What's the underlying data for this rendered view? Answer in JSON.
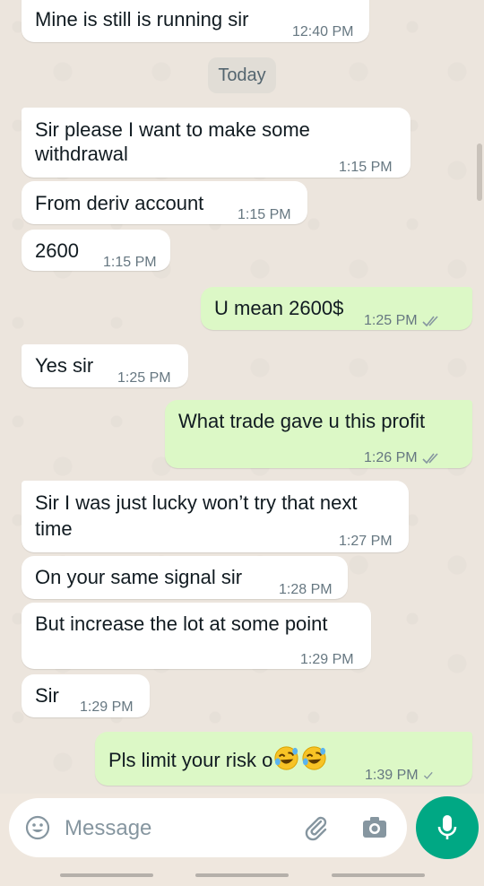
{
  "date_separator": "Today",
  "messages": [
    {
      "text": "Mine is still is running sir",
      "time": "12:40 PM",
      "direction": "in"
    },
    {
      "text_lines": [
        "Sir please I want to make some",
        "withdrawal"
      ],
      "time": "1:15 PM",
      "direction": "in"
    },
    {
      "text": "From deriv account",
      "time": "1:15 PM",
      "direction": "in"
    },
    {
      "text": "2600",
      "time": "1:15 PM",
      "direction": "in"
    },
    {
      "text": "U mean 2600$",
      "time": "1:25 PM",
      "direction": "out",
      "status": "read"
    },
    {
      "text": "Yes sir",
      "time": "1:25 PM",
      "direction": "in"
    },
    {
      "text": "What trade gave u this profit",
      "time": "1:26 PM",
      "direction": "out",
      "status": "read"
    },
    {
      "text_lines": [
        "Sir I was just lucky won’t try that next",
        "time"
      ],
      "time": "1:27 PM",
      "direction": "in"
    },
    {
      "text": "On your same signal sir",
      "time": "1:28 PM",
      "direction": "in"
    },
    {
      "text": "But increase the lot at some point",
      "time": "1:29 PM",
      "direction": "in"
    },
    {
      "text": "Sir",
      "time": "1:29 PM",
      "direction": "in"
    },
    {
      "text": "Pls limit your risk o",
      "emoji": [
        "rolling-on-floor-laughing",
        "rolling-on-floor-laughing"
      ],
      "time": "1:39 PM",
      "direction": "out",
      "status": "delivered"
    }
  ],
  "composer": {
    "placeholder": "Message"
  },
  "colors": {
    "incoming_bubble": "#ffffff",
    "outgoing_bubble": "#dcf8c6",
    "chat_background": "#ece5dd",
    "send_button": "#00a884",
    "timestamp": "#667781",
    "read_ticks": "#8696a0"
  },
  "icons": [
    "emoji-icon",
    "attachment-icon",
    "camera-icon",
    "microphone-icon",
    "double-check-icon",
    "single-check-icon"
  ]
}
